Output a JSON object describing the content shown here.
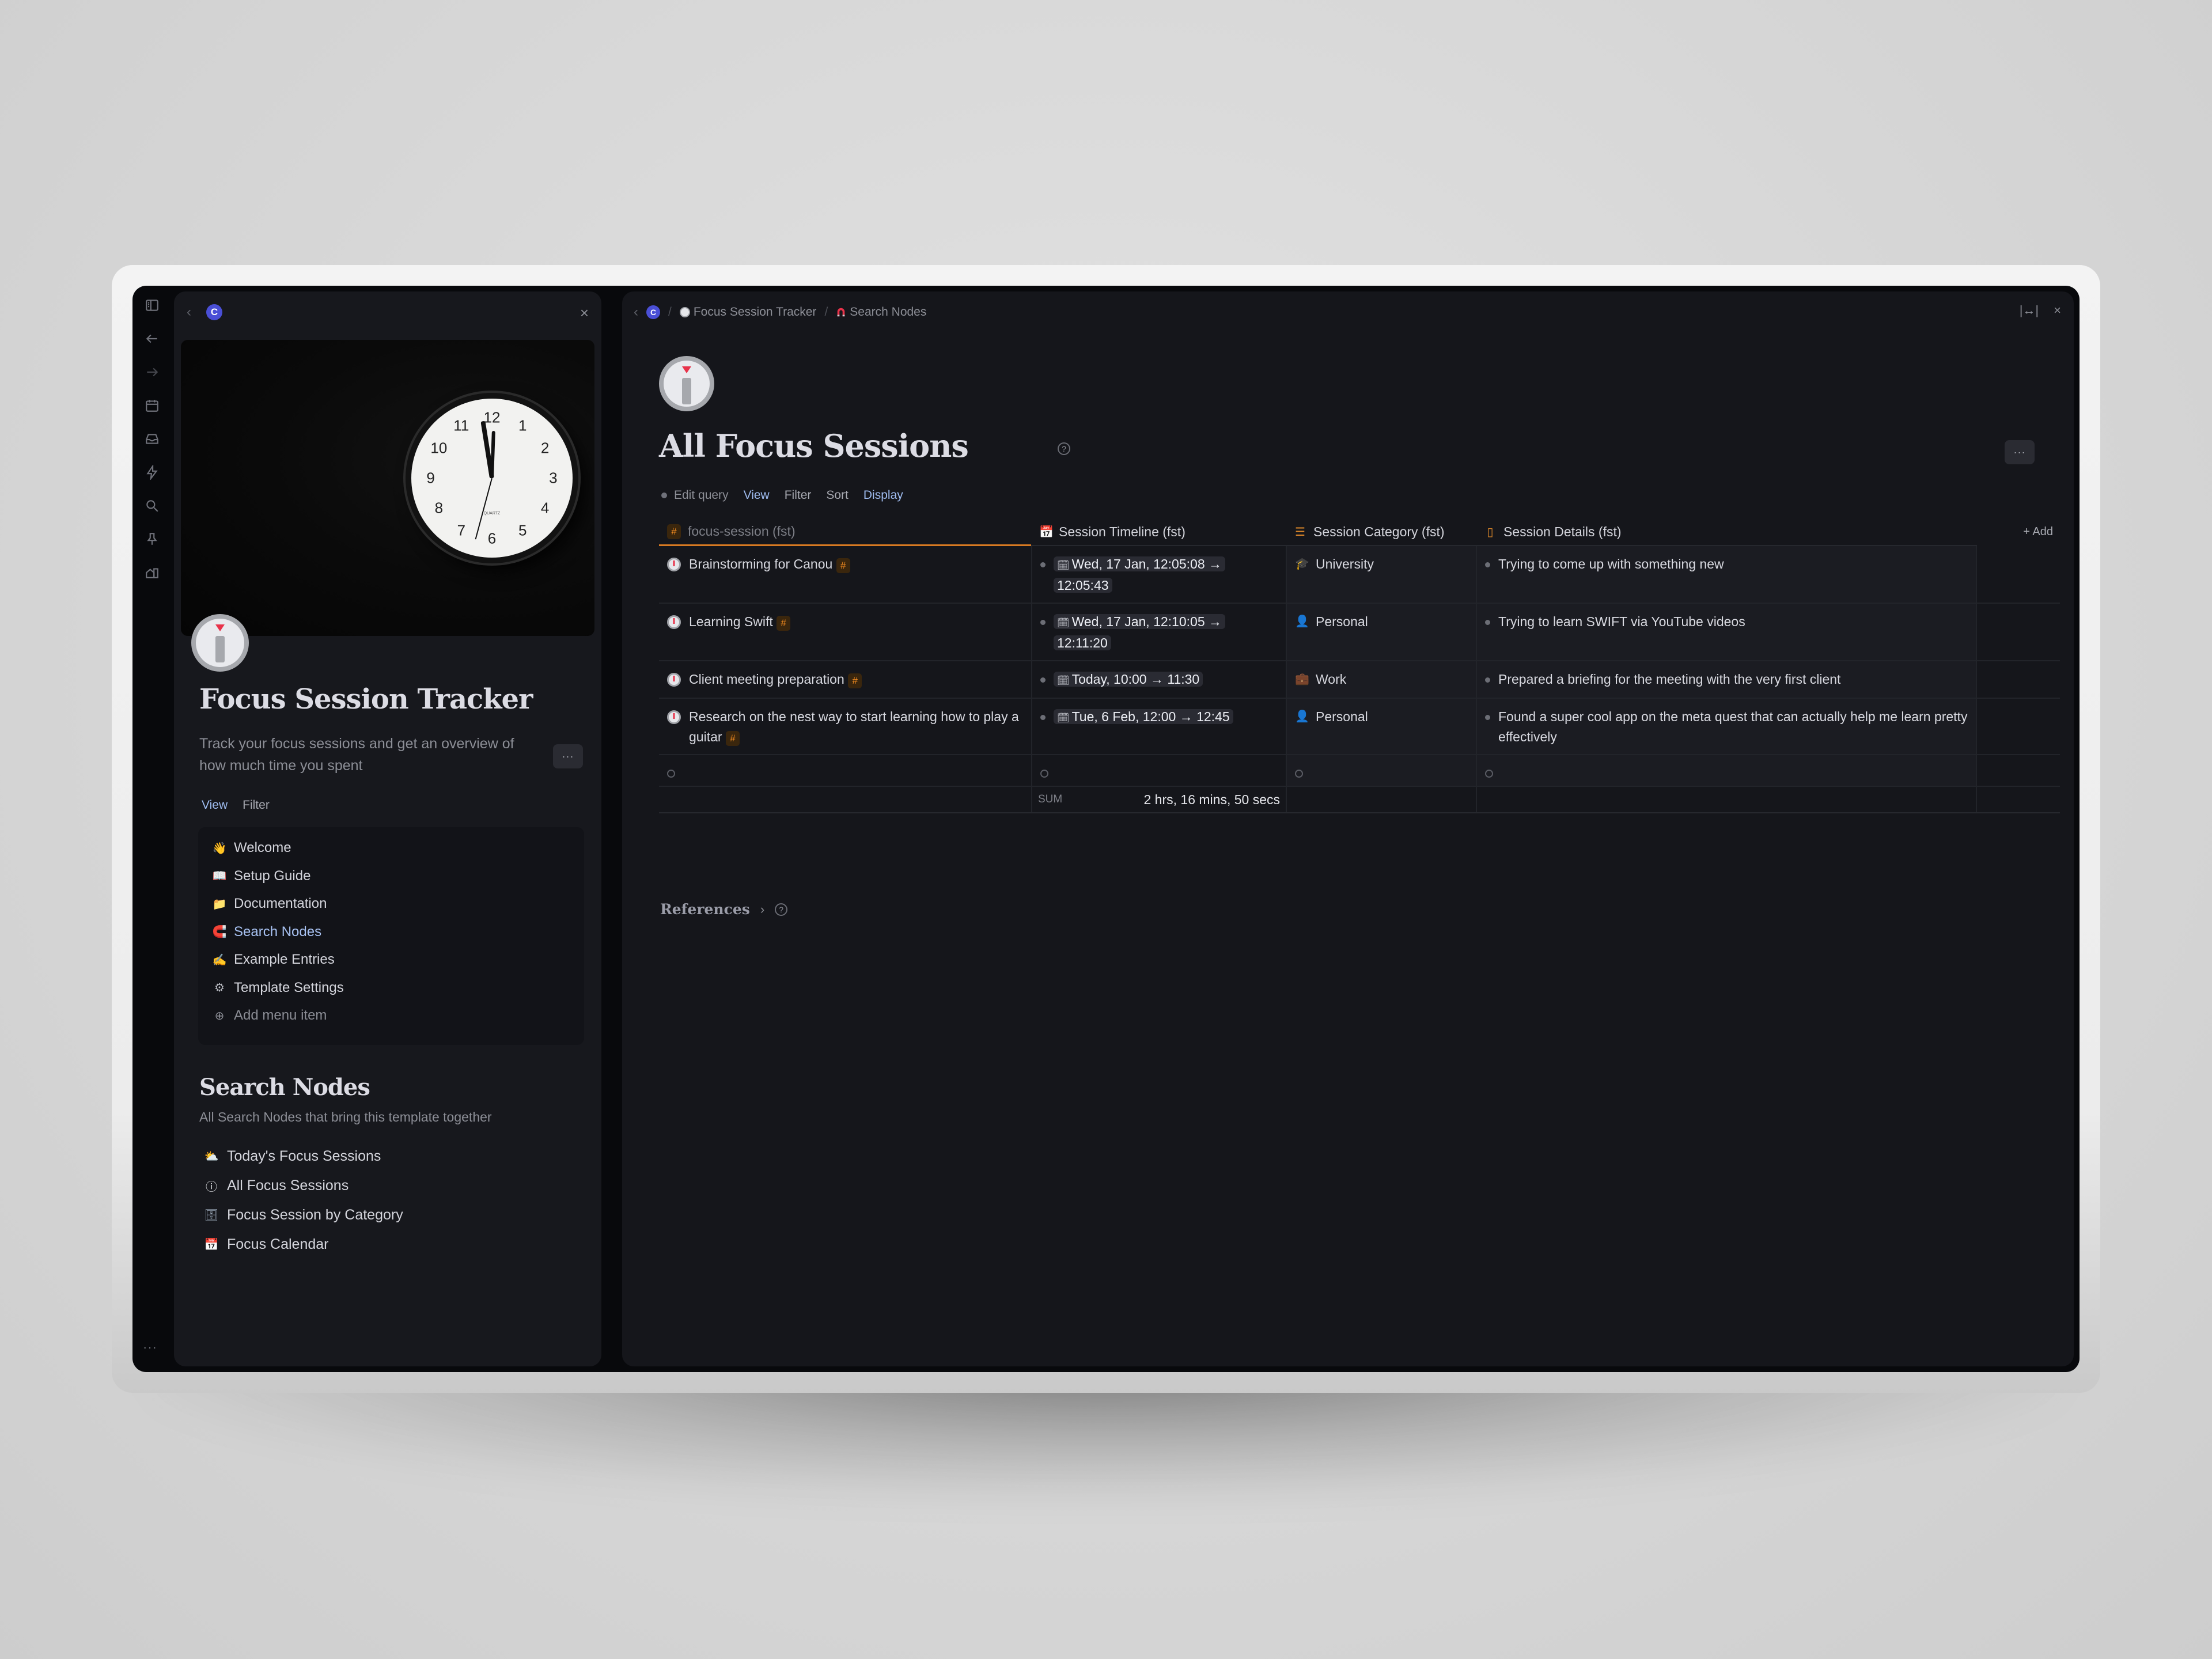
{
  "rail": {
    "icons": [
      "sidebar-toggle-icon",
      "back-arrow-icon",
      "forward-arrow-icon",
      "calendar-icon",
      "inbox-icon",
      "lightning-icon",
      "search-icon",
      "pin-icon",
      "workspace-icon"
    ],
    "more": "···"
  },
  "left_panel": {
    "workspace_badge": "C",
    "title": "Focus Session Tracker",
    "description": "Track your focus sessions and get an overview of how much time you spent",
    "more_label": "···",
    "tabs": [
      {
        "label": "View",
        "active": true
      },
      {
        "label": "Filter",
        "active": false
      }
    ],
    "menu": [
      {
        "icon": "👋",
        "label": "Welcome"
      },
      {
        "icon": "📖",
        "label": "Setup Guide"
      },
      {
        "icon": "📁",
        "label": "Documentation"
      },
      {
        "icon": "🧲",
        "label": "Search Nodes",
        "active": true
      },
      {
        "icon": "✍",
        "label": "Example Entries"
      },
      {
        "icon": "⚙",
        "label": "Template Settings"
      }
    ],
    "add_menu_item": "Add menu item",
    "search_nodes": {
      "title": "Search Nodes",
      "description": "All Search Nodes that bring this template together",
      "items": [
        {
          "icon": "⛅",
          "label": "Today's Focus Sessions"
        },
        {
          "icon": "ⓘ",
          "label": "All Focus Sessions"
        },
        {
          "icon": "🗄",
          "label": "Focus Session by Category"
        },
        {
          "icon": "📅",
          "label": "Focus Calendar"
        }
      ]
    },
    "cover_clock_numbers": [
      "12",
      "1",
      "2",
      "3",
      "4",
      "5",
      "6",
      "7",
      "8",
      "9",
      "10",
      "11"
    ],
    "cover_clock_brand": "QUARTZ"
  },
  "right_panel": {
    "breadcrumb": [
      {
        "badge": "C"
      },
      {
        "label": "Focus Session Tracker",
        "icon": "focus-icon"
      },
      {
        "label": "Search Nodes",
        "icon": "magnet-icon"
      }
    ],
    "title": "All Focus Sessions",
    "more_label": "···",
    "query_bar": {
      "edit_query": "Edit query",
      "view": "View",
      "filter": "Filter",
      "sort": "Sort",
      "display": "Display"
    },
    "table": {
      "columns": [
        {
          "label": "focus-session (fst)",
          "icon": "#"
        },
        {
          "label": "Session Timeline (fst)",
          "icon": "calendar"
        },
        {
          "label": "Session Category (fst)",
          "icon": "list"
        },
        {
          "label": "Session Details (fst)",
          "icon": "text"
        }
      ],
      "add_column": "+ Add",
      "rows": [
        {
          "name": "Brainstorming for Canou",
          "timeline": "Wed, 17 Jan, 12:05:08 → 12:05:43",
          "category_icon": "🎓",
          "category": "University",
          "details": "Trying to come up with something new"
        },
        {
          "name": "Learning Swift",
          "timeline": "Wed, 17 Jan, 12:10:05 → 12:11:20",
          "category_icon": "👤",
          "category": "Personal",
          "details": "Trying to learn SWIFT via YouTube videos"
        },
        {
          "name": "Client meeting preparation",
          "timeline": "Today, 10:00 → 11:30",
          "category_icon": "💼",
          "category": "Work",
          "details": "Prepared a briefing for the meeting with the very first client"
        },
        {
          "name": "Research on the nest way to start learning how to play a guitar",
          "timeline": "Tue, 6 Feb, 12:00 → 12:45",
          "category_icon": "👤",
          "category": "Personal",
          "details": "Found a super cool app on the meta quest that can actually help me learn pretty effectively"
        }
      ],
      "sum_label": "SUM",
      "sum_value": "2 hrs, 16 mins, 50 secs"
    },
    "references": "References"
  },
  "colors": {
    "accent_blue": "#9fbcf0",
    "tag_orange": "#f08a20",
    "workspace_badge": "#4a4fd6"
  }
}
